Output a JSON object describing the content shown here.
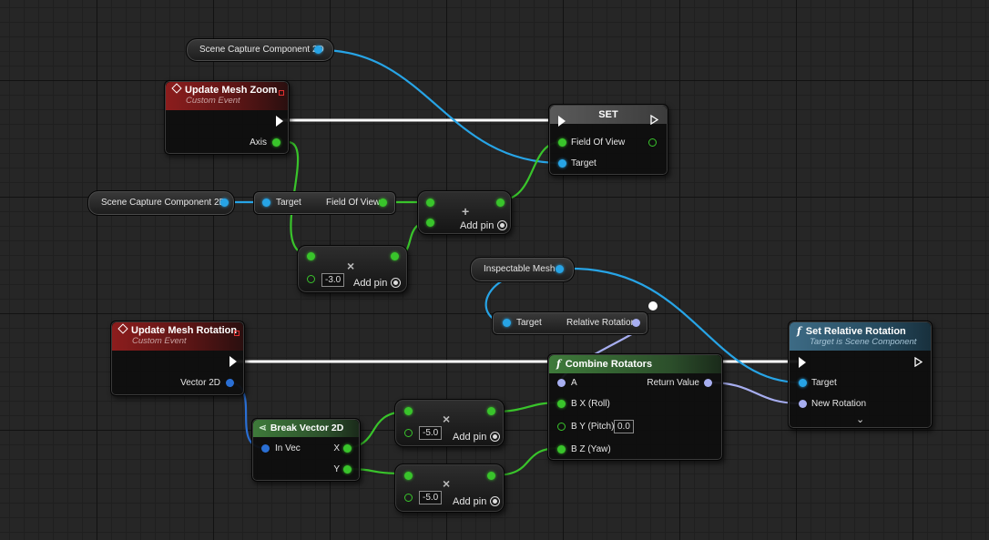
{
  "variables": {
    "scene_capture_top": "Scene Capture Component 2D",
    "scene_capture_left": "Scene Capture Component 2D",
    "inspectable_mesh": "Inspectable Mesh"
  },
  "update_mesh_zoom": {
    "title": "Update Mesh Zoom",
    "subtitle": "Custom Event",
    "pin_axis": "Axis"
  },
  "set_node": {
    "title": "SET",
    "pin_fov": "Field Of View",
    "pin_target": "Target"
  },
  "get_fov": {
    "pin_target": "Target",
    "pin_fov": "Field Of View"
  },
  "add_node": {
    "symbol": "+",
    "add_pin": "Add pin"
  },
  "multiply_zoom": {
    "symbol": "×",
    "value": "-3.0",
    "add_pin": "Add pin"
  },
  "get_rel_rot": {
    "pin_target": "Target",
    "pin_rel_rot": "Relative Rotation"
  },
  "update_mesh_rotation": {
    "title": "Update Mesh Rotation",
    "subtitle": "Custom Event",
    "pin_vector": "Vector 2D"
  },
  "break_vector": {
    "title": "Break Vector 2D",
    "pin_in": "In Vec",
    "pin_x": "X",
    "pin_y": "Y"
  },
  "multiply_x": {
    "symbol": "×",
    "value": "-5.0",
    "add_pin": "Add pin"
  },
  "multiply_y": {
    "symbol": "×",
    "value": "-5.0",
    "add_pin": "Add pin"
  },
  "combine_rotators": {
    "title": "Combine Rotators",
    "pin_a": "A",
    "pin_return": "Return Value",
    "pin_roll": "B X (Roll)",
    "pin_pitch": "B Y (Pitch)",
    "pitch_value": "0.0",
    "pin_yaw": "B Z (Yaw)"
  },
  "set_relative_rotation": {
    "title": "Set Relative Rotation",
    "subtitle": "Target is Scene Component",
    "pin_target": "Target",
    "pin_new_rot": "New Rotation"
  },
  "colors": {
    "object_pin": "#27a4e6",
    "float_pin": "#39c42b",
    "rotator_pin": "#a7aef0",
    "exec_wire": "#ffffff",
    "vector2d_pin": "#2a6fd4"
  }
}
